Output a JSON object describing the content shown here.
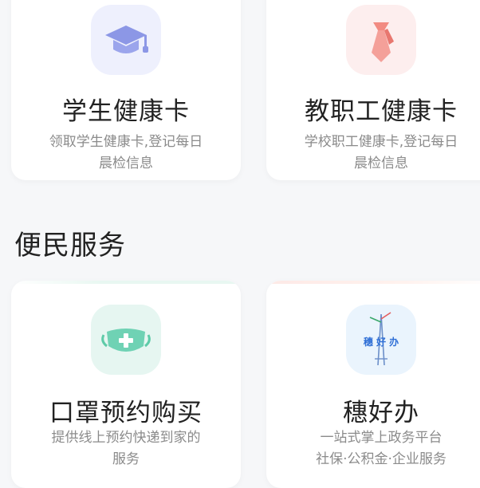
{
  "cards_top": [
    {
      "title": "学生健康卡",
      "desc_line1": "领取学生健康卡,登记每日",
      "desc_line2": "晨检信息",
      "icon": "graduation-cap-icon"
    },
    {
      "title": "教职工健康卡",
      "desc_line1": "学校职工健康卡,登记每日",
      "desc_line2": "晨检信息",
      "icon": "necktie-icon"
    }
  ],
  "section": {
    "title": "便民服务"
  },
  "cards_bottom": [
    {
      "title": "口罩预约购买",
      "desc_line1": "提供线上预约快递到家的",
      "desc_line2": "服务",
      "icon": "face-mask-icon"
    },
    {
      "title": "穗好办",
      "desc_line1": "一站式掌上政务平台",
      "desc_line2": "社保·公积金·企业服务",
      "icon": "suihaoban-logo-icon",
      "logo_text": "穗 好 办"
    }
  ],
  "colors": {
    "student_icon_bg": "#eef0fd",
    "student_icon": "#8c97e6",
    "staff_icon_bg": "#fdeeee",
    "staff_icon": "#f28b82",
    "mask_icon_bg": "#e6f6f1",
    "mask_icon": "#5ecba8",
    "suihaoban_icon_bg": "#eaf4fd",
    "suihaoban_icon": "#2f6fd6"
  }
}
